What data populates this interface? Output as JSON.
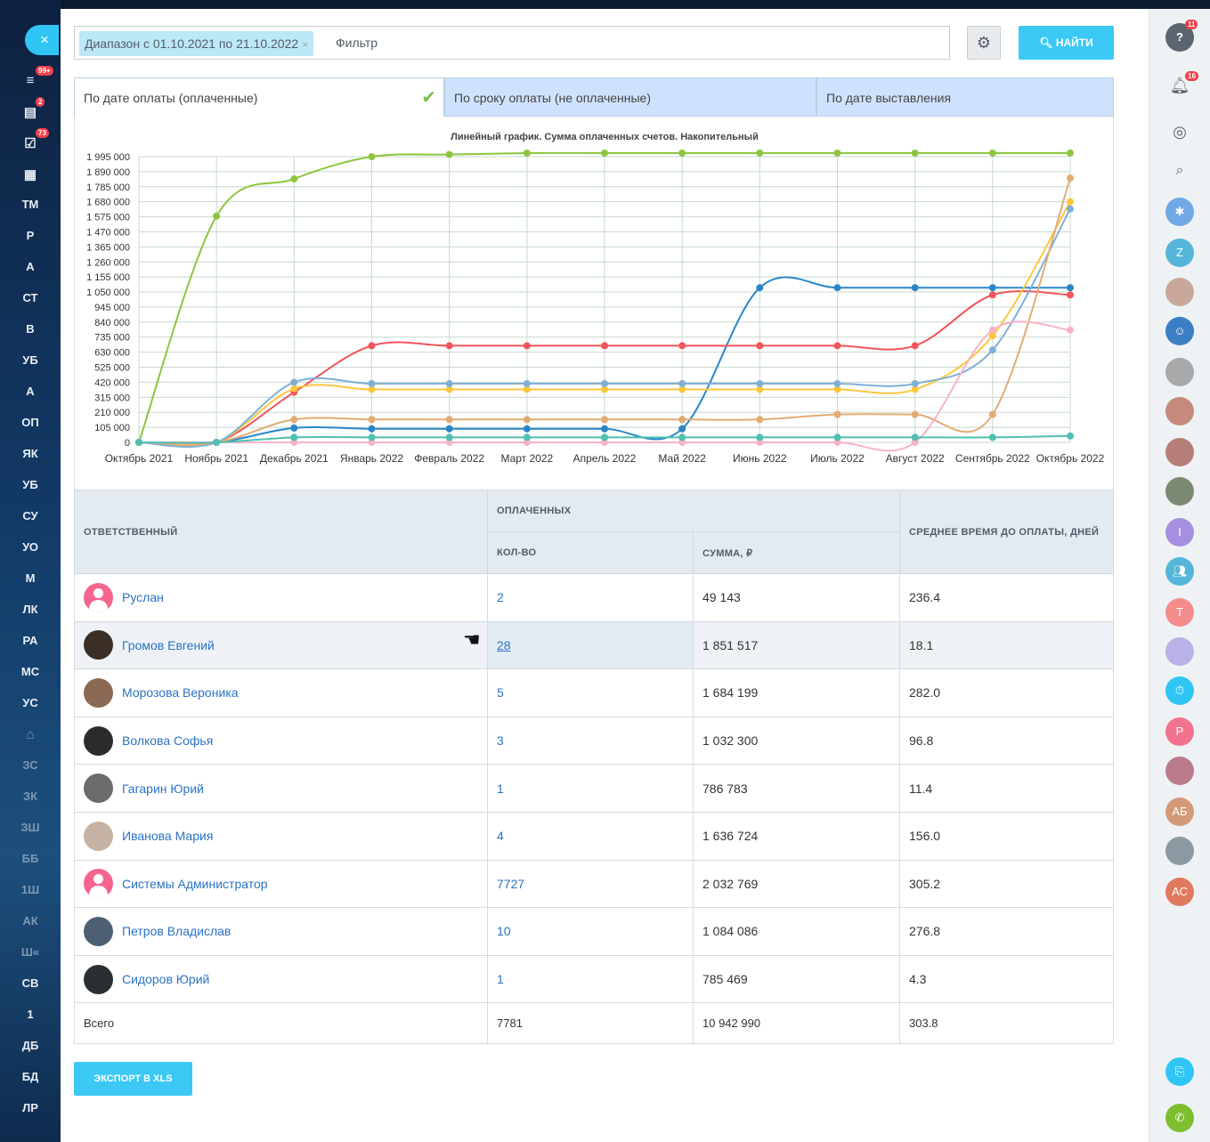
{
  "left_nav": {
    "close_glyph": "×",
    "items": [
      {
        "label": "≡",
        "icon": "filter-icon",
        "badge": "99+"
      },
      {
        "label": "▤",
        "icon": "inbox-icon",
        "badge": "2"
      },
      {
        "label": "☑",
        "icon": "tasks-icon",
        "badge": "73"
      },
      {
        "label": "▦",
        "icon": "document-icon",
        "badge": ""
      },
      {
        "label": "ТМ"
      },
      {
        "label": "Р"
      },
      {
        "label": "А"
      },
      {
        "label": "СТ"
      },
      {
        "label": "В"
      },
      {
        "label": "УБ"
      },
      {
        "label": "А"
      },
      {
        "label": "ОП"
      },
      {
        "label": "ЯК"
      },
      {
        "label": "УБ"
      },
      {
        "label": "СУ"
      },
      {
        "label": "УО"
      },
      {
        "label": "М"
      },
      {
        "label": "ЛК"
      },
      {
        "label": "РА"
      },
      {
        "label": "МС"
      },
      {
        "label": "УС"
      },
      {
        "label": "⌂",
        "icon": "robot-icon"
      },
      {
        "label": "ЗС"
      },
      {
        "label": "ЗК"
      },
      {
        "label": "ЗШ"
      },
      {
        "label": "ББ"
      },
      {
        "label": "1Ш"
      },
      {
        "label": "АК"
      },
      {
        "label": "Ш«"
      },
      {
        "label": "СВ"
      },
      {
        "label": "1"
      },
      {
        "label": "ДБ"
      },
      {
        "label": "БД"
      },
      {
        "label": "ЛР"
      }
    ]
  },
  "filter": {
    "chip_label": "Диапазон с 01.10.2021 по 21.10.2022",
    "chip_close": "×",
    "placeholder": "Фильтр",
    "find_label": "НАЙТИ"
  },
  "tabs": [
    {
      "label": "По дате оплаты (оплаченные)",
      "active": true
    },
    {
      "label": "По сроку оплаты (не оплаченные)",
      "active": false
    },
    {
      "label": "По дате выставления",
      "active": false
    }
  ],
  "chart_data": {
    "type": "line",
    "title": "Линейный график. Сумма оплаченных счетов. Накопительный",
    "categories": [
      "Октябрь 2021",
      "Ноябрь 2021",
      "Декабрь 2021",
      "Январь 2022",
      "Февраль 2022",
      "Март 2022",
      "Апрель 2022",
      "Май 2022",
      "Июнь 2022",
      "Июль 2022",
      "Август 2022",
      "Сентябрь 2022",
      "Октябрь 2022"
    ],
    "y_ticks": [
      "0",
      "105 000",
      "210 000",
      "315 000",
      "420 000",
      "525 000",
      "630 000",
      "735 000",
      "840 000",
      "945 000",
      "1 050 000",
      "1 155 000",
      "1 260 000",
      "1 365 000",
      "1 470 000",
      "1 575 000",
      "1 680 000",
      "1 785 000",
      "1 890 000",
      "1 995 000"
    ],
    "ylim": [
      0,
      1995000
    ],
    "grid": true,
    "series": [
      {
        "color": "#8cc63f",
        "values": [
          0,
          1580000,
          1840000,
          1995000,
          2010000,
          2020000,
          2020000,
          2020000,
          2020000,
          2020000,
          2020000,
          2020000,
          2020000
        ]
      },
      {
        "color": "#2a86c8",
        "values": [
          0,
          0,
          100000,
          95000,
          95000,
          95000,
          95000,
          95000,
          1080000,
          1080000,
          1080000,
          1080000,
          1080000
        ]
      },
      {
        "color": "#f2545b",
        "values": [
          0,
          0,
          350000,
          675000,
          675000,
          675000,
          675000,
          675000,
          675000,
          675000,
          675000,
          1030000,
          1030000
        ]
      },
      {
        "color": "#ffc63d",
        "values": [
          0,
          0,
          375000,
          370000,
          370000,
          370000,
          370000,
          370000,
          370000,
          370000,
          370000,
          745000,
          1680000
        ]
      },
      {
        "color": "#7fb0d6",
        "values": [
          0,
          0,
          420000,
          410000,
          410000,
          410000,
          410000,
          410000,
          410000,
          410000,
          410000,
          645000,
          1630000
        ]
      },
      {
        "color": "#e2ab74",
        "values": [
          0,
          0,
          160000,
          160000,
          160000,
          160000,
          160000,
          160000,
          160000,
          195000,
          195000,
          195000,
          1845000
        ]
      },
      {
        "color": "#f6b3c8",
        "values": [
          0,
          0,
          0,
          0,
          0,
          0,
          0,
          0,
          0,
          0,
          0,
          785000,
          785000
        ]
      },
      {
        "color": "#4fbfb2",
        "values": [
          0,
          0,
          35000,
          35000,
          35000,
          35000,
          35000,
          35000,
          35000,
          35000,
          35000,
          35000,
          45000
        ]
      }
    ]
  },
  "table": {
    "headers": {
      "responsible": "ОТВЕТСТВЕННЫЙ",
      "paid": "ОПЛАЧЕННЫХ",
      "count": "КОЛ-ВО",
      "sum": "СУММА, ₽",
      "avg": "СРЕДНЕЕ ВРЕМЯ ДО ОПЛАТЫ, ДНЕЙ"
    },
    "rows": [
      {
        "name": "Руслан",
        "count": "2",
        "sum": "49 143",
        "avg": "236.4",
        "avatar": "default-avatar"
      },
      {
        "name": "Громов Евгений",
        "count": "28",
        "sum": "1 851 517",
        "avg": "18.1",
        "avatar": "photo-avatar"
      },
      {
        "name": "Морозова Вероника",
        "count": "5",
        "sum": "1 684 199",
        "avg": "282.0",
        "avatar": "photo-avatar"
      },
      {
        "name": "Волкова Софья",
        "count": "3",
        "sum": "1 032 300",
        "avg": "96.8",
        "avatar": "photo-avatar"
      },
      {
        "name": "Гагарин Юрий",
        "count": "1",
        "sum": "786 783",
        "avg": "11.4",
        "avatar": "photo-avatar"
      },
      {
        "name": "Иванова Мария",
        "count": "4",
        "sum": "1 636 724",
        "avg": "156.0",
        "avatar": "photo-avatar"
      },
      {
        "name": "Системы Администратор",
        "count": "7727",
        "sum": "2 032 769",
        "avg": "305.2",
        "avatar": "default-avatar"
      },
      {
        "name": "Петров Владислав",
        "count": "10",
        "sum": "1 084 086",
        "avg": "276.8",
        "avatar": "photo-avatar"
      },
      {
        "name": "Сидоров Юрий",
        "count": "1",
        "sum": "785 469",
        "avg": "4.3",
        "avatar": "photo-avatar"
      }
    ],
    "total": {
      "label": "Всего",
      "count": "7781",
      "sum": "10 942 990",
      "avg": "303.8"
    }
  },
  "export_label": "ЭКСПОРТ В XLS",
  "right_panel": {
    "help_badge": "11",
    "notify_badge": "16",
    "avatars": [
      {
        "letter": "Z",
        "color": "#55b6d9"
      },
      {
        "letter": "I",
        "color": "#a58fe0"
      },
      {
        "letter": "T",
        "color": "#f58c8c"
      },
      {
        "letter": "P",
        "color": "#f2738e"
      },
      {
        "letter": "АБ",
        "color": "#d49a78"
      },
      {
        "letter": "АС",
        "color": "#e0795e"
      }
    ]
  }
}
